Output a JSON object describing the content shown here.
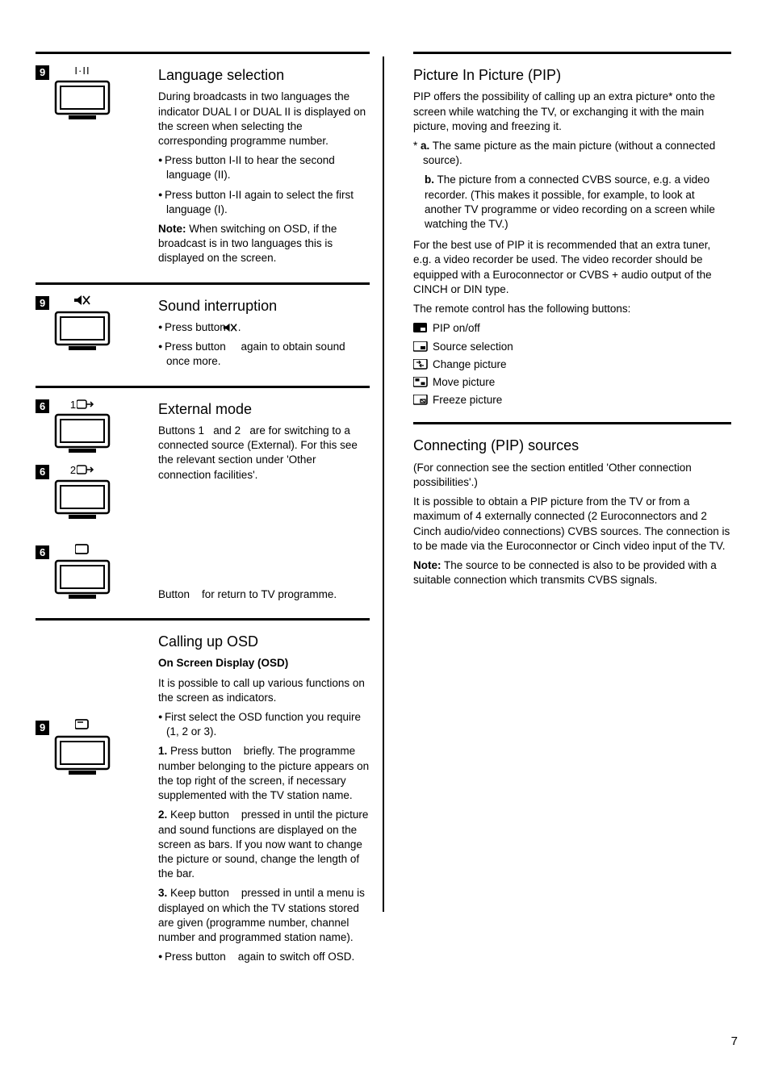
{
  "page_number": "7",
  "left": {
    "language": {
      "fig": {
        "tag": "9",
        "label": "I·II"
      },
      "heading": "Language selection",
      "p1": "During broadcasts in two languages the indicator DUAL I or DUAL II is displayed on the screen when selecting the corresponding programme number.",
      "b1": "Press button I-II to hear the second language (II).",
      "b2": "Press button I-II again to select the first language (I).",
      "note_label": "Note:",
      "note": " When switching on OSD, if the broadcast is in two languages this is displayed on the screen."
    },
    "sound": {
      "fig": {
        "tag": "9",
        "label": "mute"
      },
      "heading": "Sound interruption",
      "b1": "Press button    .",
      "b2": "Press button     again to obtain sound once more."
    },
    "external": {
      "heading": "External mode",
      "fig1": {
        "tag": "6",
        "label": "1"
      },
      "fig2": {
        "tag": "6",
        "label": "2"
      },
      "fig3": {
        "tag": "6",
        "label": "rect"
      },
      "p1": "Buttons 1   and 2   are for switching to a connected source (External). For this see the relevant section under 'Other connection facilities'.",
      "p2": "Button    for return to TV programme."
    },
    "osd": {
      "heading": "Calling up OSD",
      "sub": "On Screen Display (OSD)",
      "p1": "It is possible to call up various functions on the screen as indicators.",
      "b1": "First select the OSD function you require (1, 2 or 3).",
      "fig": {
        "tag": "9",
        "label": "osd"
      },
      "s1_label": "1.",
      "s1": " Press button    briefly. The programme number belonging to the picture appears on the top right of the screen, if necessary supplemented with the TV station name.",
      "s2_label": "2.",
      "s2": " Keep button    pressed in until the picture and sound functions are displayed on the screen as bars. If you now want to change the picture or sound, change the length of the bar.",
      "s3_label": "3.",
      "s3": " Keep button    pressed in until a menu is displayed on which the TV stations stored are given (programme number, channel number and programmed station name).",
      "b2": "Press button    again to switch off OSD."
    }
  },
  "right": {
    "pip": {
      "heading": "Picture In Picture (PIP)",
      "p1": "PIP offers the possibility of calling up an extra picture* onto the screen while watching the TV, or exchanging it with the main picture, moving and freezing it.",
      "a_label": "a.",
      "a": " The same picture as the main picture (without a connected source).",
      "b_label": "b.",
      "b": " The picture from a connected CVBS source, e.g. a video recorder. (This makes it possible, for example, to look at another TV programme or video recording on a screen while watching the TV.)",
      "p2": "For the best use of PIP it is recommended that an extra tuner, e.g. a video recorder be used. The video recorder should be equipped with a Euroconnector or CVBS + audio output of the CINCH or DIN type.",
      "p3": "The remote control has the following buttons:",
      "btn1": "PIP on/off",
      "btn2": "Source selection",
      "btn3": "Change picture",
      "btn4": "Move picture",
      "btn5": "Freeze picture"
    },
    "connecting": {
      "heading": "Connecting (PIP) sources",
      "p1": "(For connection see the section entitled 'Other connection possibilities'.)",
      "p2": "It is possible to obtain a PIP picture from the TV or from a maximum of 4 externally connected (2 Euroconnectors and 2 Cinch audio/video connections) CVBS sources. The connection is to be made via the Euroconnector or Cinch video input of the TV.",
      "note_label": "Note:",
      "note": " The source to be connected is also to be provided with a suitable connection which transmits CVBS signals."
    }
  }
}
